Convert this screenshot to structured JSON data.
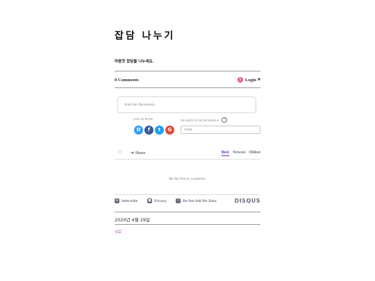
{
  "page": {
    "title": "잡담 나누기",
    "subtitle": "마음껏 잡담을 나누세요.",
    "date": "2020년 4월 29일",
    "back_link": "뒤로"
  },
  "disqus": {
    "comments_count": "0 Comments",
    "login_badge": "1",
    "login_label": "Login",
    "discussion_placeholder": "Start the discussion...",
    "login_with_label": "LOG IN WITH",
    "signup_label": "OR SIGN UP WITH DISQUS",
    "help_icon": "?",
    "name_placeholder": "Name",
    "social_logins": [
      {
        "letter": "D",
        "icon": "disqus-icon",
        "color": "#2e9fff"
      },
      {
        "letter": "f",
        "icon": "facebook-icon",
        "color": "#3b5998"
      },
      {
        "letter": "t",
        "icon": "twitter-icon",
        "color": "#1da1f2"
      },
      {
        "letter": "G",
        "icon": "google-icon",
        "color": "#dd4b39"
      }
    ],
    "share_label": "Share",
    "sort_options": [
      "Best",
      "Newest",
      "Oldest"
    ],
    "active_sort": "Best",
    "empty_message": "Be the first to comment.",
    "footer": {
      "subscribe": "Subscribe",
      "privacy": "Privacy",
      "do_not_sell": "Do Not Sell My Data",
      "logo": "DISQUS"
    },
    "accent_color": "#6a2bcc"
  }
}
